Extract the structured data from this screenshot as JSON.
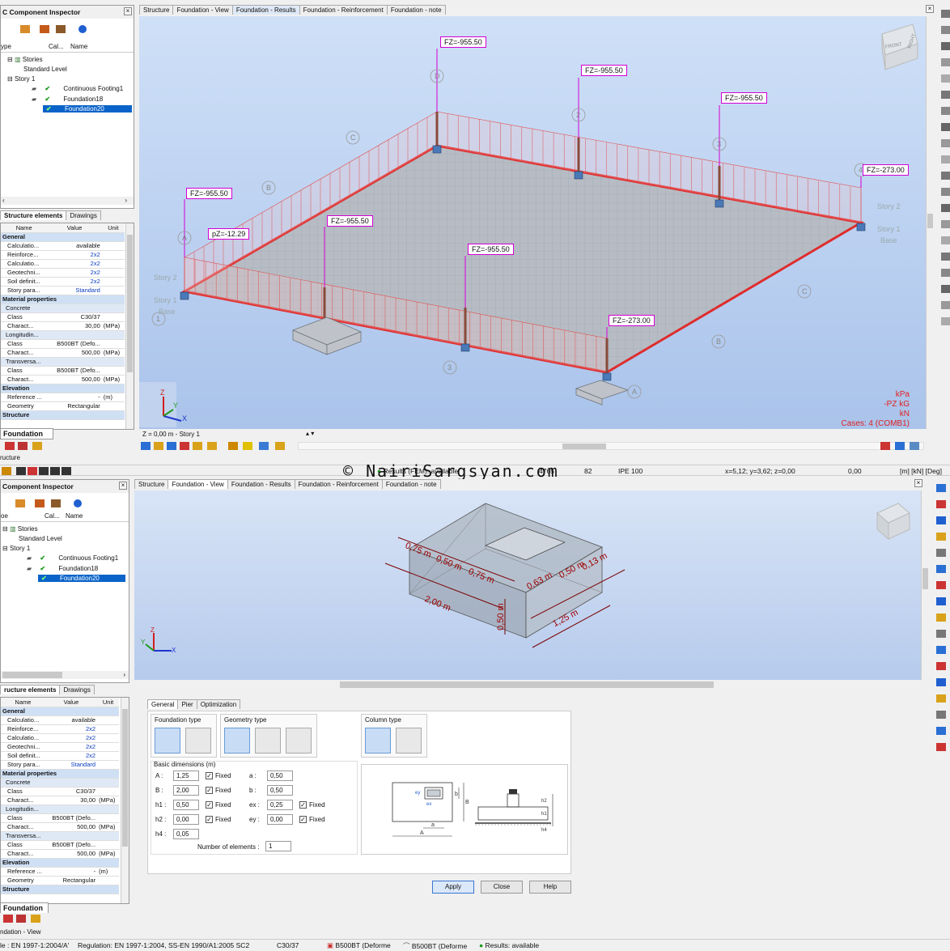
{
  "top": {
    "inspector": {
      "title": "C Component Inspector",
      "columns": [
        "ype",
        "Cal...",
        "Name"
      ],
      "tree": {
        "stories": "Stories",
        "standard_level": "Standard Level",
        "story1": "Story 1",
        "items": [
          "Continuous Footing1",
          "Foundation18",
          "Foundation20"
        ]
      },
      "tabs": [
        "Structure elements",
        "Drawings"
      ],
      "prop_headers": [
        "Name",
        "Value",
        "Unit"
      ],
      "foundation_tab": "Foundation"
    },
    "view_tabs": [
      "Structure",
      "Foundation - View",
      "Foundation - Results",
      "Foundation - Reinforcement",
      "Foundation - note"
    ],
    "fz_labels": [
      "FZ=-955.50",
      "FZ=-955.50",
      "FZ=-955.50",
      "FZ=-955.50",
      "FZ=-955.50",
      "FZ=-955.50",
      "FZ=-273.00",
      "FZ=-273.00"
    ],
    "pz_label": "pZ=-12.29",
    "axis_labels": [
      "D",
      "C",
      "B",
      "A",
      "2",
      "3",
      "4",
      "1",
      "C",
      "B",
      "A",
      "3"
    ],
    "story_labels": [
      "Story 2",
      "Story 1",
      "Base",
      "Story 2",
      "Story 1",
      "Base"
    ],
    "legend": [
      "kPa",
      "-PZ  kG",
      "kN",
      "Cases: 4 (COMB1)"
    ],
    "z_readout": "Z = 0,00 m - Story 1",
    "cube_faces": [
      "FRONT",
      "RIGHT"
    ]
  },
  "middle": {
    "structure_label": "ructure",
    "watermark": "©  NairiSargsyan.com",
    "results_label": "Results (FEM): available",
    "numbers": [
      "4765",
      "82"
    ],
    "section": "IPE 100",
    "coords": "x=5,12; y=3,62; z=0,00",
    "angle": "0,00",
    "units": "[m] [kN] [Deg]"
  },
  "bottom": {
    "inspector": {
      "title": "Component Inspector",
      "columns": [
        "oe",
        "Cal...",
        "Name"
      ],
      "tree": {
        "stories": "Stories",
        "standard_level": "Standard Level",
        "story1": "Story 1",
        "items": [
          "Continuous Footing1",
          "Foundation18",
          "Foundation20"
        ]
      },
      "tabs": [
        "ructure elements",
        "Drawings"
      ],
      "prop_headers": [
        "Name",
        "Value",
        "Unit"
      ],
      "foundation_tab": "Foundation"
    },
    "view_tabs": [
      "Structure",
      "Foundation - View",
      "Foundation - Results",
      "Foundation - Reinforcement",
      "Foundation - note"
    ],
    "dims": [
      "0,75 m",
      "0,50 m",
      "0,75 m",
      "2,00 m",
      "0,63 m",
      "0,50 m",
      "0,13 m",
      "1,25 m",
      "0,50 m"
    ],
    "dialog": {
      "tabs": [
        "General",
        "Pier",
        "Optimization"
      ],
      "foundation_type": "Foundation type",
      "geometry_type": "Geometry type",
      "column_type": "Column type",
      "basic_dims": "Basic dimensions (m)",
      "fields": [
        {
          "label": "A :",
          "value": "1,25",
          "fixed": "Fixed"
        },
        {
          "label": "B :",
          "value": "2,00",
          "fixed": "Fixed"
        },
        {
          "label": "h1 :",
          "value": "0,50",
          "fixed": "Fixed"
        },
        {
          "label": "h2 :",
          "value": "0,00",
          "fixed": "Fixed"
        },
        {
          "label": "h4 :",
          "value": "0,05"
        }
      ],
      "fields2": [
        {
          "label": "a :",
          "value": "0,50"
        },
        {
          "label": "b :",
          "value": "0,50"
        },
        {
          "label": "ex :",
          "value": "0,25",
          "fixed": "Fixed"
        },
        {
          "label": "ey :",
          "value": "0,00",
          "fixed": "Fixed"
        }
      ],
      "num_elements_label": "Number of elements :",
      "num_elements": "1",
      "buttons": [
        "Apply",
        "Close",
        "Help"
      ]
    },
    "view_label": "ndation - View",
    "status": [
      "le : EN 1997-1:2004/A'",
      "Regulation: EN 1997-1:2004, SS-EN 1990/A1:2005 SC2",
      "C30/37",
      "B500BT (Deforme",
      "B500BT (Deforme",
      "Results: available"
    ]
  },
  "props": [
    {
      "type": "grp",
      "name": "General"
    },
    {
      "name": "Calculatio...",
      "value": "available",
      "unit": ""
    },
    {
      "name": "Reinforce...",
      "value": "2x2",
      "unit": "",
      "blue": true
    },
    {
      "name": "Calculatio...",
      "value": "2x2",
      "unit": "",
      "blue": true
    },
    {
      "name": "Geotechni...",
      "value": "2x2",
      "unit": "",
      "blue": true
    },
    {
      "name": "Soil definit...",
      "value": "2x2",
      "unit": "",
      "blue": true
    },
    {
      "name": "Story para...",
      "value": "Standard",
      "unit": "",
      "blue": true
    },
    {
      "type": "grp",
      "name": "Material properties"
    },
    {
      "type": "sub",
      "name": "Concrete"
    },
    {
      "name": "Class",
      "value": "C30/37",
      "unit": ""
    },
    {
      "name": "Charact...",
      "value": "30,00",
      "unit": "(MPa)"
    },
    {
      "type": "sub",
      "name": "Longitudin..."
    },
    {
      "name": "Class",
      "value": "B500BT (Defo...",
      "unit": ""
    },
    {
      "name": "Charact...",
      "value": "500,00",
      "unit": "(MPa)"
    },
    {
      "type": "sub",
      "name": "Transversa..."
    },
    {
      "name": "Class",
      "value": "B500BT (Defo...",
      "unit": ""
    },
    {
      "name": "Charact...",
      "value": "500,00",
      "unit": "(MPa)"
    },
    {
      "type": "grp",
      "name": "Elevation"
    },
    {
      "name": "Reference ...",
      "value": "-",
      "unit": "(m)"
    },
    {
      "name": "Geometry",
      "value": "Rectangular",
      "unit": ""
    },
    {
      "type": "grp",
      "name": "Structure"
    }
  ],
  "colors": {
    "selection": "#0a63c9",
    "load": "#e05050",
    "slab_edge": "#e02a2a",
    "dim": "#a00000",
    "fz_border": "#d400d4"
  }
}
